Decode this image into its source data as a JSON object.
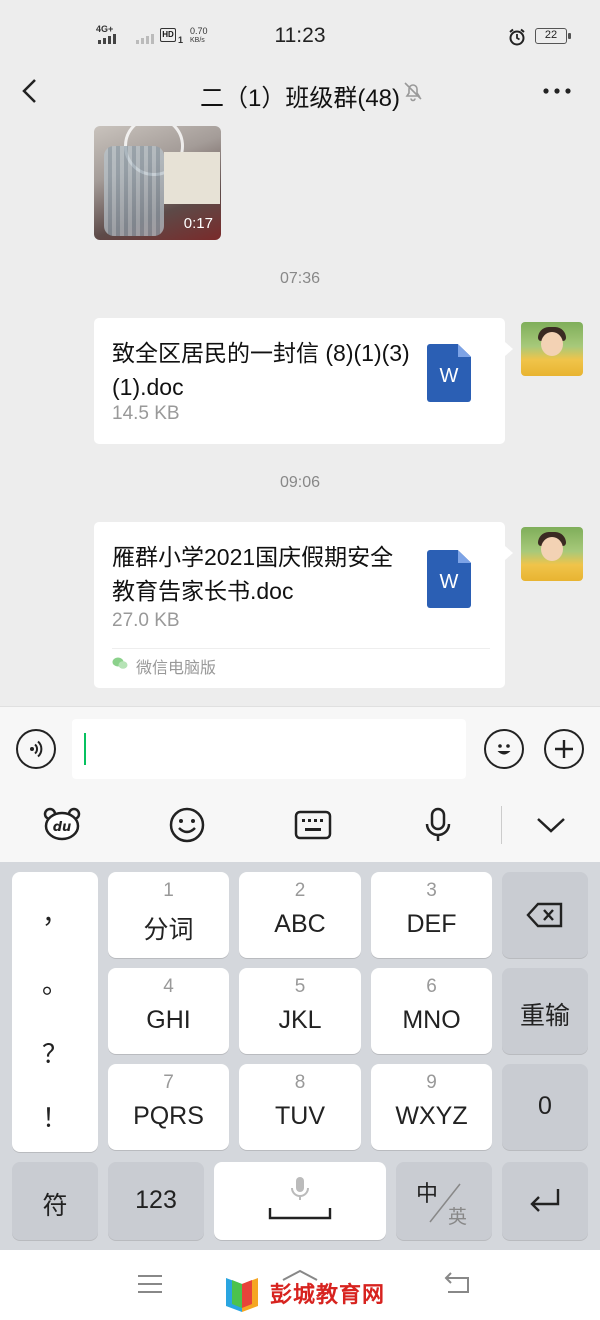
{
  "status_bar": {
    "network": "4G+",
    "hd": "HD",
    "hd_sub": "1",
    "speed_value": "0.70",
    "speed_unit": "KB/s",
    "time": "11:23",
    "battery": "22"
  },
  "header": {
    "title": "二（1）班级群(48)",
    "back_icon": "chevron-left-icon",
    "mute_icon": "bell-off-icon",
    "more_icon": "more-dots-icon"
  },
  "chat": {
    "video": {
      "duration": "0:17"
    },
    "messages": [
      {
        "time": "07:36",
        "file_name": "致全区居民的一封信 (8)(1)(3)(1).doc",
        "file_size": "14.5 KB",
        "file_icon_letter": "W"
      },
      {
        "time": "09:06",
        "file_name": "雁群小学2021国庆假期安全教育告家长书.doc",
        "file_size": "27.0 KB",
        "file_icon_letter": "W",
        "source": "微信电脑版"
      }
    ]
  },
  "input_bar": {
    "voice_icon": "voice-wave-icon",
    "emoji_icon": "smiley-icon",
    "plus_icon": "plus-icon",
    "value": ""
  },
  "keyboard_toolbar": {
    "icons": [
      "du-bear-icon",
      "emoji-icon",
      "keyboard-icon",
      "microphone-icon",
      "chevron-down-icon"
    ]
  },
  "keyboard": {
    "punct": [
      "，",
      "。",
      "？",
      "！"
    ],
    "keys": [
      {
        "num": "1",
        "label": "分词"
      },
      {
        "num": "2",
        "label": "ABC"
      },
      {
        "num": "3",
        "label": "DEF"
      },
      {
        "num": "4",
        "label": "GHI"
      },
      {
        "num": "5",
        "label": "JKL"
      },
      {
        "num": "6",
        "label": "MNO"
      },
      {
        "num": "7",
        "label": "PQRS"
      },
      {
        "num": "8",
        "label": "TUV"
      },
      {
        "num": "9",
        "label": "WXYZ"
      }
    ],
    "reenter": "重输",
    "zero": "0",
    "symbol": "符",
    "numeric": "123",
    "lang_main": "中",
    "lang_alt": "英",
    "backspace_icon": "backspace-icon",
    "enter_icon": "enter-icon",
    "space_mic_icon": "microphone-icon"
  },
  "nav_bar": {
    "menu_icon": "menu-lines-icon",
    "home_icon": "home-chevron-icon",
    "back_icon": "return-arrow-icon",
    "watermark": "彭城教育网"
  }
}
